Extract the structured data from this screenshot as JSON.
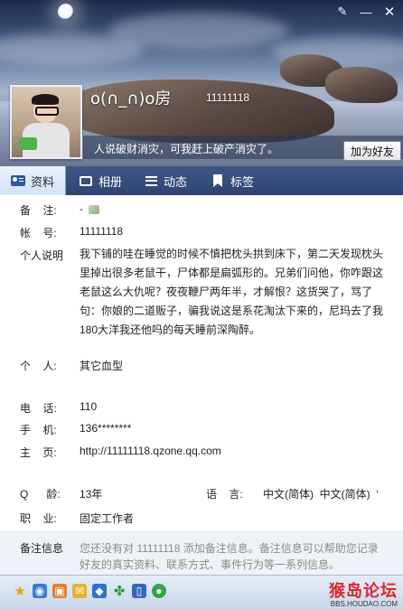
{
  "header": {
    "nickname": "o(∩_∩)o房",
    "qq_number": "11111118",
    "signature": "人说破财消灾，可我赶上破产消灾了。",
    "add_friend_label": "加为好友"
  },
  "window_controls": {
    "icons": [
      "brush-icon",
      "minimize-icon",
      "close-icon"
    ]
  },
  "tabs": [
    {
      "label": "资料",
      "icon": "profile-card-icon",
      "active": true
    },
    {
      "label": "相册",
      "icon": "album-icon",
      "active": false
    },
    {
      "label": "动态",
      "icon": "feed-icon",
      "active": false
    },
    {
      "label": "标签",
      "icon": "tag-icon",
      "active": false
    }
  ],
  "info": {
    "remark_label": "备    注:",
    "remark_value": "-",
    "account_label": "帐    号:",
    "account_value": "11111118",
    "bio_label": "个人说明",
    "bio_value": "我下铺的哇在睡觉的时候不慎把枕头拱到床下，第二天发现枕头里掉出很多老鼠干，尸体都是扁弧形的。兄弟们问他，你咋跟这老鼠这么大仇呢？夜夜鞭尸两年半，才解恨？这货哭了，骂了句：你娘的二道贩子，骗我说这是系花淘汰下来的，尼玛去了我180大洋我还他吗的每天睡前深陶醉。",
    "personal_label": "个    人:",
    "personal_value": "其它血型",
    "phone_label": "电    话:",
    "phone_value": "110",
    "mobile_label": "手    机:",
    "mobile_value": "136********",
    "homepage_label": "主    页:",
    "homepage_value": "http://11111118.qzone.qq.com",
    "age_label": "Q      龄:",
    "age_value": "13年",
    "language_label": "语    言:",
    "language_value": "中文(简体)  中文(简体)  ‘",
    "job_label": "职    业:",
    "job_value": "固定工作者",
    "remark_info_label": "备注信息",
    "remark_info_value": "您还没有对 11111118 添加备注信息。备注信息可以帮助您记录好友的真实资料、联系方式、事件行为等一系列信息。"
  },
  "toolbar": {
    "icons": [
      "star-icon",
      "camera-icon",
      "gift-icon",
      "mail-icon",
      "shield-icon",
      "clover-icon",
      "phone-icon",
      "globe-icon"
    ],
    "watermark_main": "猴岛论坛",
    "watermark_sub": "BBS.HOUDAO.COM"
  }
}
